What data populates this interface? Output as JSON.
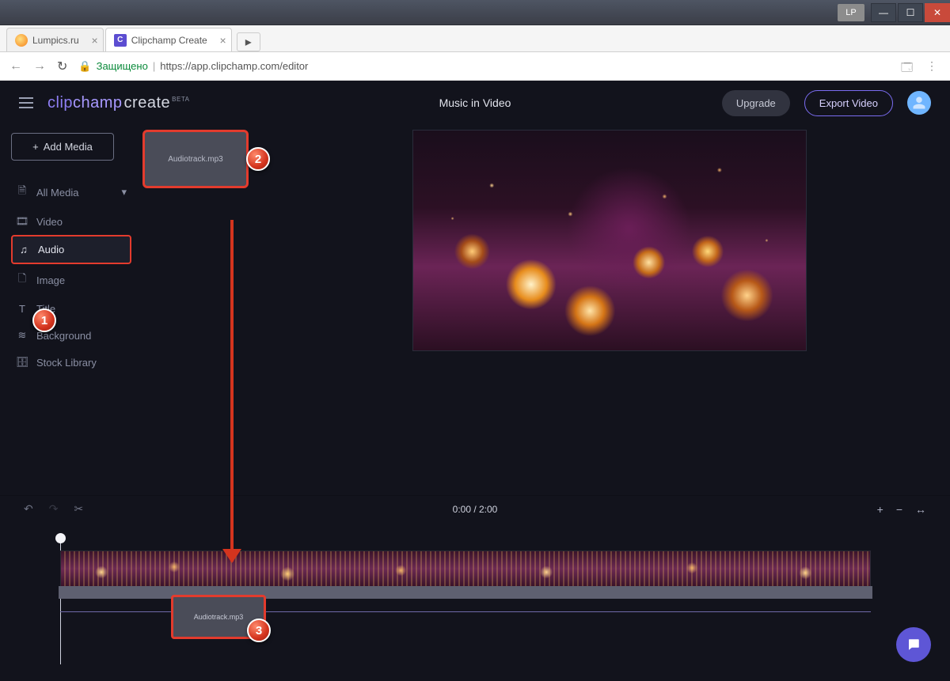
{
  "window": {
    "lpBadge": "LP"
  },
  "tabs": [
    {
      "title": "Lumpics.ru",
      "iconClass": "lumpics"
    },
    {
      "title": "Clipchamp Create",
      "iconClass": "cc",
      "iconLetter": "C"
    }
  ],
  "addressBar": {
    "secureLabel": "Защищено",
    "url": "https://app.clipchamp.com/editor"
  },
  "header": {
    "logoClip": "clip",
    "logoChamp": "champ",
    "logoCreate": "create",
    "logoBeta": "BETA",
    "projectTitle": "Music in Video",
    "upgrade": "Upgrade",
    "export": "Export Video"
  },
  "sidebar": {
    "addMedia": "Add Media",
    "items": [
      {
        "label": "All Media",
        "name": "all-media"
      },
      {
        "label": "Video",
        "name": "video"
      },
      {
        "label": "Audio",
        "name": "audio",
        "active": true
      },
      {
        "label": "Image",
        "name": "image"
      },
      {
        "label": "Title",
        "name": "title"
      },
      {
        "label": "Background",
        "name": "background"
      },
      {
        "label": "Stock Library",
        "name": "stock-library"
      }
    ]
  },
  "media": {
    "thumbLabel": "Audiotrack.mp3"
  },
  "toolbar": {
    "timecode": "0:00 / 2:00"
  },
  "timelineItem": {
    "label": "Audiotrack.mp3"
  },
  "callouts": {
    "c1": "1",
    "c2": "2",
    "c3": "3"
  }
}
